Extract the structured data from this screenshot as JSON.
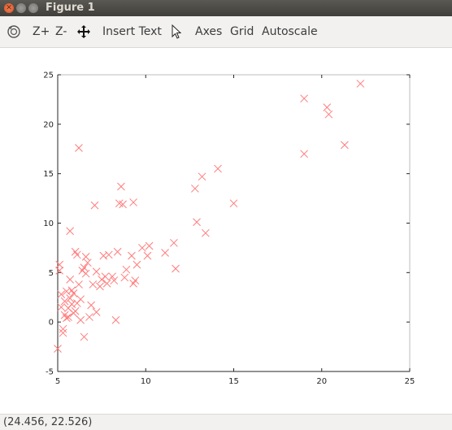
{
  "window": {
    "title": "Figure 1"
  },
  "toolbar": {
    "zoom_in_label": "Z+",
    "zoom_out_label": "Z-",
    "insert_text_label": "Insert Text",
    "axes_label": "Axes",
    "grid_label": "Grid",
    "autoscale_label": "Autoscale",
    "icons": [
      "rotate-icon",
      "pan-arrows-icon",
      "select-pointer-icon"
    ]
  },
  "status": {
    "coordinates": "(24.456, 22.526)"
  },
  "colors": {
    "marker": "#ff7b7b",
    "axis": "#262626",
    "box": "#bdbdbd"
  },
  "chart_data": {
    "type": "scatter",
    "marker": "x",
    "xlim": [
      5,
      25
    ],
    "ylim": [
      -5,
      25
    ],
    "xticks": [
      5,
      10,
      15,
      20,
      25
    ],
    "yticks": [
      -5,
      0,
      5,
      10,
      15,
      20,
      25
    ],
    "grid": false,
    "points": [
      [
        5.0,
        -2.7
      ],
      [
        5.1,
        5.2
      ],
      [
        5.1,
        5.8
      ],
      [
        5.2,
        2.8
      ],
      [
        5.2,
        1.5
      ],
      [
        5.3,
        -0.7
      ],
      [
        5.3,
        -1.1
      ],
      [
        5.4,
        2.1
      ],
      [
        5.4,
        0.7
      ],
      [
        5.5,
        0.4
      ],
      [
        5.5,
        3.1
      ],
      [
        5.6,
        1.4
      ],
      [
        5.6,
        0.5
      ],
      [
        5.7,
        9.2
      ],
      [
        5.7,
        2.4
      ],
      [
        5.7,
        4.3
      ],
      [
        5.8,
        3.2
      ],
      [
        5.8,
        1.8
      ],
      [
        5.9,
        0.9
      ],
      [
        5.9,
        2.9
      ],
      [
        6.0,
        7.1
      ],
      [
        6.0,
        1.1
      ],
      [
        6.1,
        6.8
      ],
      [
        6.1,
        1.9
      ],
      [
        6.2,
        17.6
      ],
      [
        6.2,
        3.8
      ],
      [
        6.3,
        0.2
      ],
      [
        6.3,
        2.3
      ],
      [
        6.4,
        5.2
      ],
      [
        6.5,
        -1.5
      ],
      [
        6.5,
        5.5
      ],
      [
        6.6,
        6.6
      ],
      [
        6.6,
        4.9
      ],
      [
        6.7,
        6.0
      ],
      [
        6.8,
        0.5
      ],
      [
        6.9,
        1.7
      ],
      [
        7.0,
        3.8
      ],
      [
        7.1,
        11.8
      ],
      [
        7.2,
        5.1
      ],
      [
        7.2,
        1.0
      ],
      [
        7.4,
        3.6
      ],
      [
        7.5,
        4.3
      ],
      [
        7.6,
        6.7
      ],
      [
        7.7,
        4.6
      ],
      [
        7.8,
        3.9
      ],
      [
        7.9,
        6.8
      ],
      [
        8.1,
        4.6
      ],
      [
        8.2,
        4.2
      ],
      [
        8.3,
        0.2
      ],
      [
        8.4,
        7.1
      ],
      [
        8.5,
        12.0
      ],
      [
        8.6,
        13.7
      ],
      [
        8.7,
        11.9
      ],
      [
        8.8,
        4.5
      ],
      [
        8.9,
        5.3
      ],
      [
        9.2,
        6.7
      ],
      [
        9.3,
        12.1
      ],
      [
        9.3,
        3.9
      ],
      [
        9.4,
        4.2
      ],
      [
        9.5,
        5.8
      ],
      [
        9.8,
        7.5
      ],
      [
        10.1,
        6.7
      ],
      [
        10.2,
        7.7
      ],
      [
        11.1,
        7.0
      ],
      [
        11.6,
        8.0
      ],
      [
        11.7,
        5.4
      ],
      [
        12.8,
        13.5
      ],
      [
        12.9,
        10.1
      ],
      [
        13.2,
        14.7
      ],
      [
        13.4,
        9.0
      ],
      [
        14.1,
        15.5
      ],
      [
        15.0,
        12.0
      ],
      [
        19.0,
        22.6
      ],
      [
        19.0,
        17.0
      ],
      [
        20.3,
        21.7
      ],
      [
        20.4,
        21.0
      ],
      [
        21.3,
        17.9
      ],
      [
        22.2,
        24.1
      ]
    ]
  }
}
